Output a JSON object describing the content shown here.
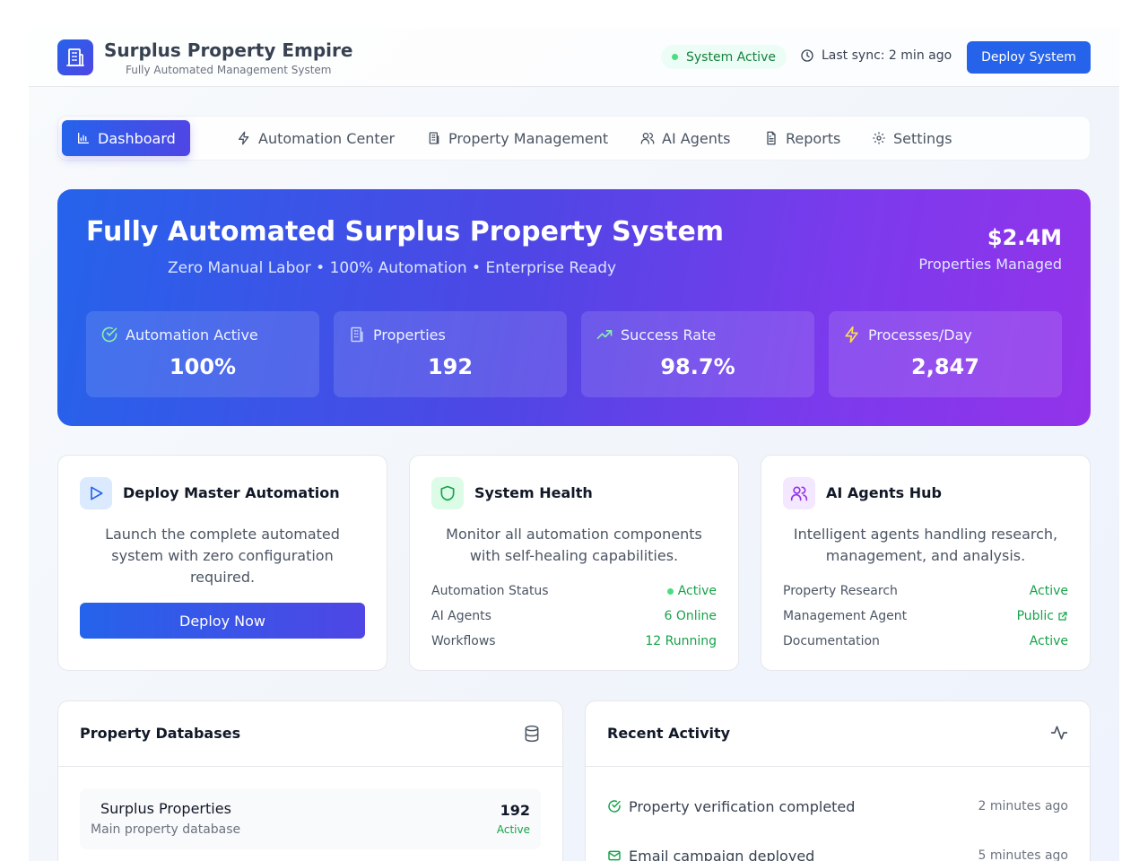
{
  "header": {
    "title": "Surplus Property Empire",
    "subtitle": "Fully Automated Management System",
    "status": "System Active",
    "sync": "Last sync: 2 min ago",
    "deploy_label": "Deploy System"
  },
  "tabs": [
    {
      "label": "Dashboard",
      "icon": "bar-chart-icon",
      "active": true
    },
    {
      "label": "Automation Center",
      "icon": "lightning-icon"
    },
    {
      "label": "Property Management",
      "icon": "building-icon"
    },
    {
      "label": "AI Agents",
      "icon": "users-icon"
    },
    {
      "label": "Reports",
      "icon": "document-icon"
    },
    {
      "label": "Settings",
      "icon": "gear-icon"
    }
  ],
  "hero": {
    "title": "Fully Automated Surplus Property System",
    "subtitle": "Zero Manual Labor • 100% Automation • Enterprise Ready",
    "money": "$2.4M",
    "money_label": "Properties Managed",
    "stats": [
      {
        "label": "Automation Active",
        "value": "100%",
        "icon": "check-circle-icon"
      },
      {
        "label": "Properties",
        "value": "192",
        "icon": "building-icon"
      },
      {
        "label": "Success Rate",
        "value": "98.7%",
        "icon": "trending-up-icon"
      },
      {
        "label": "Processes/Day",
        "value": "2,847",
        "icon": "lightning-icon"
      }
    ]
  },
  "cards": {
    "deploy": {
      "title": "Deploy Master Automation",
      "desc": "Launch the complete automated system with zero configuration required.",
      "button": "Deploy Now"
    },
    "health": {
      "title": "System Health",
      "desc": "Monitor all automation components with self-healing capabilities.",
      "rows": [
        {
          "k": "Automation Status",
          "v": "Active"
        },
        {
          "k": "AI Agents",
          "v": "6 Online"
        },
        {
          "k": "Workflows",
          "v": "12 Running"
        }
      ]
    },
    "agents": {
      "title": "AI Agents Hub",
      "desc": "Intelligent agents handling research, management, and analysis.",
      "rows": [
        {
          "k": "Property Research",
          "v": "Active"
        },
        {
          "k": "Management Agent",
          "v": "Public"
        },
        {
          "k": "Documentation",
          "v": "Active"
        }
      ]
    }
  },
  "databases": {
    "title": "Property Databases",
    "items": [
      {
        "name": "Surplus Properties",
        "desc": "Main property database",
        "count": "192",
        "status": "Active"
      }
    ]
  },
  "activity": {
    "title": "Recent Activity",
    "items": [
      {
        "text": "Property verification completed",
        "time": "2 minutes ago"
      },
      {
        "text": "Email campaign deployed",
        "time": "5 minutes ago"
      }
    ]
  },
  "colors": {
    "primary": "#2563eb",
    "indigo": "#4f46e5",
    "purple": "#9333ea",
    "success": "#16a34a"
  }
}
